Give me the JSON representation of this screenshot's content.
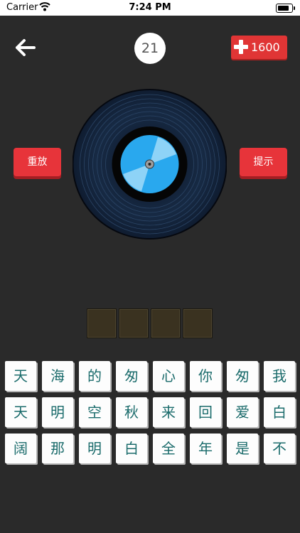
{
  "status_bar": {
    "carrier": "Carrier",
    "time": "7:24 PM"
  },
  "header": {
    "level": "21",
    "coins": "1600"
  },
  "buttons": {
    "replay_label": "重放",
    "hint_label": "提示"
  },
  "answer_slots": [
    "",
    "",
    "",
    ""
  ],
  "char_grid": [
    [
      "天",
      "海",
      "的",
      "匆",
      "心",
      "你",
      "匆",
      "我"
    ],
    [
      "天",
      "明",
      "空",
      "秋",
      "来",
      "回",
      "爱",
      "白"
    ],
    [
      "阔",
      "那",
      "明",
      "白",
      "全",
      "年",
      "是",
      "不"
    ]
  ],
  "colors": {
    "accent": "#e7343a",
    "background": "#2a2a2a",
    "char_text": "#1a6b6b",
    "disc_label": "#29a8ee"
  },
  "icons": {
    "back": "arrow-left-icon",
    "wifi": "wifi-icon",
    "battery": "battery-icon",
    "plus": "plus-icon",
    "disc": "vinyl-record-icon"
  }
}
